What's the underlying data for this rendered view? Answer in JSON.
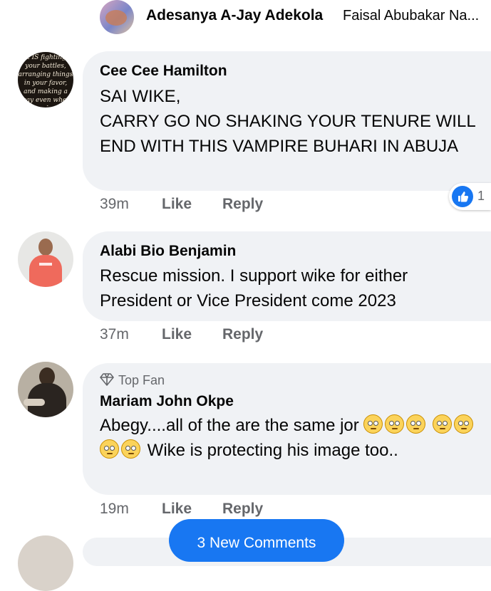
{
  "header": {
    "author_name": "Adesanya A-Jay Adekola",
    "tagged_name": "Faisal Abubakar Na..."
  },
  "comments": [
    {
      "author": "Cee Cee Hamilton",
      "text": "SAI WIKE,\n CARRY GO NO SHAKING YOUR TENURE WILL END WITH THIS VAMPIRE BUHARI IN ABUJA",
      "time": "39m",
      "like_label": "Like",
      "reply_label": "Reply",
      "reaction_count": "1",
      "avatar_quote": "it IS fighting your battles, arranging things in your favor, and making a way even when you don't"
    },
    {
      "author": "Alabi Bio Benjamin",
      "text": "Rescue mission. I support wike for either President or Vice President come 2023",
      "time": "37m",
      "like_label": "Like",
      "reply_label": "Reply"
    },
    {
      "badge": "Top Fan",
      "author": "Mariam John Okpe",
      "text_start": "Abegy....all of the are the same jor",
      "text_end": "Wike is protecting his image too..",
      "time": "19m",
      "like_label": "Like",
      "reply_label": "Reply"
    }
  ],
  "new_comments_button": "3 New Comments",
  "colors": {
    "bubble": "#f0f2f5",
    "meta": "#65676b",
    "accent": "#1877f2"
  }
}
